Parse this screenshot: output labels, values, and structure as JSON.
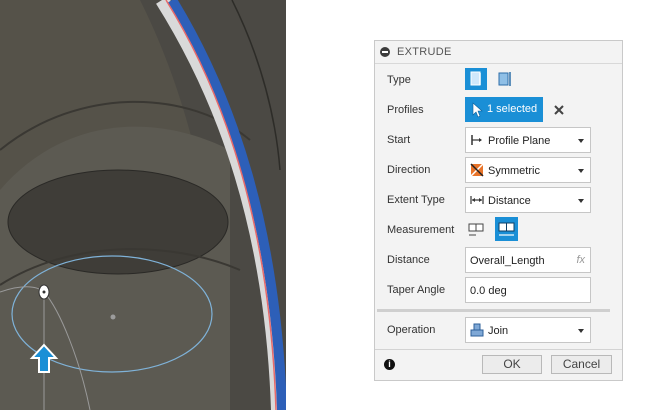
{
  "panel": {
    "title": "EXTRUDE",
    "type": {
      "label": "Type",
      "options": [
        "solid-extrude-icon",
        "thin-extrude-icon"
      ],
      "selected": 0
    },
    "profiles": {
      "label": "Profiles",
      "value": "1 selected"
    },
    "start": {
      "label": "Start",
      "value": "Profile Plane"
    },
    "direction": {
      "label": "Direction",
      "value": "Symmetric"
    },
    "extent_type": {
      "label": "Extent Type",
      "value": "Distance"
    },
    "measurement": {
      "label": "Measurement",
      "options": [
        "half-length-icon",
        "whole-length-icon"
      ],
      "selected": 1
    },
    "distance": {
      "label": "Distance",
      "value": "Overall_Length",
      "fx": "fx"
    },
    "taper_angle": {
      "label": "Taper Angle",
      "value": "0.0 deg"
    },
    "operation": {
      "label": "Operation",
      "value": "Join"
    },
    "ok_label": "OK",
    "cancel_label": "Cancel"
  },
  "colors": {
    "accent": "#1a8fd6",
    "model_face": "#4e4c45",
    "edge_blue": "#2d5fb8",
    "edge_red": "#e86a6a",
    "sketch_line": "#7fb2d8"
  }
}
